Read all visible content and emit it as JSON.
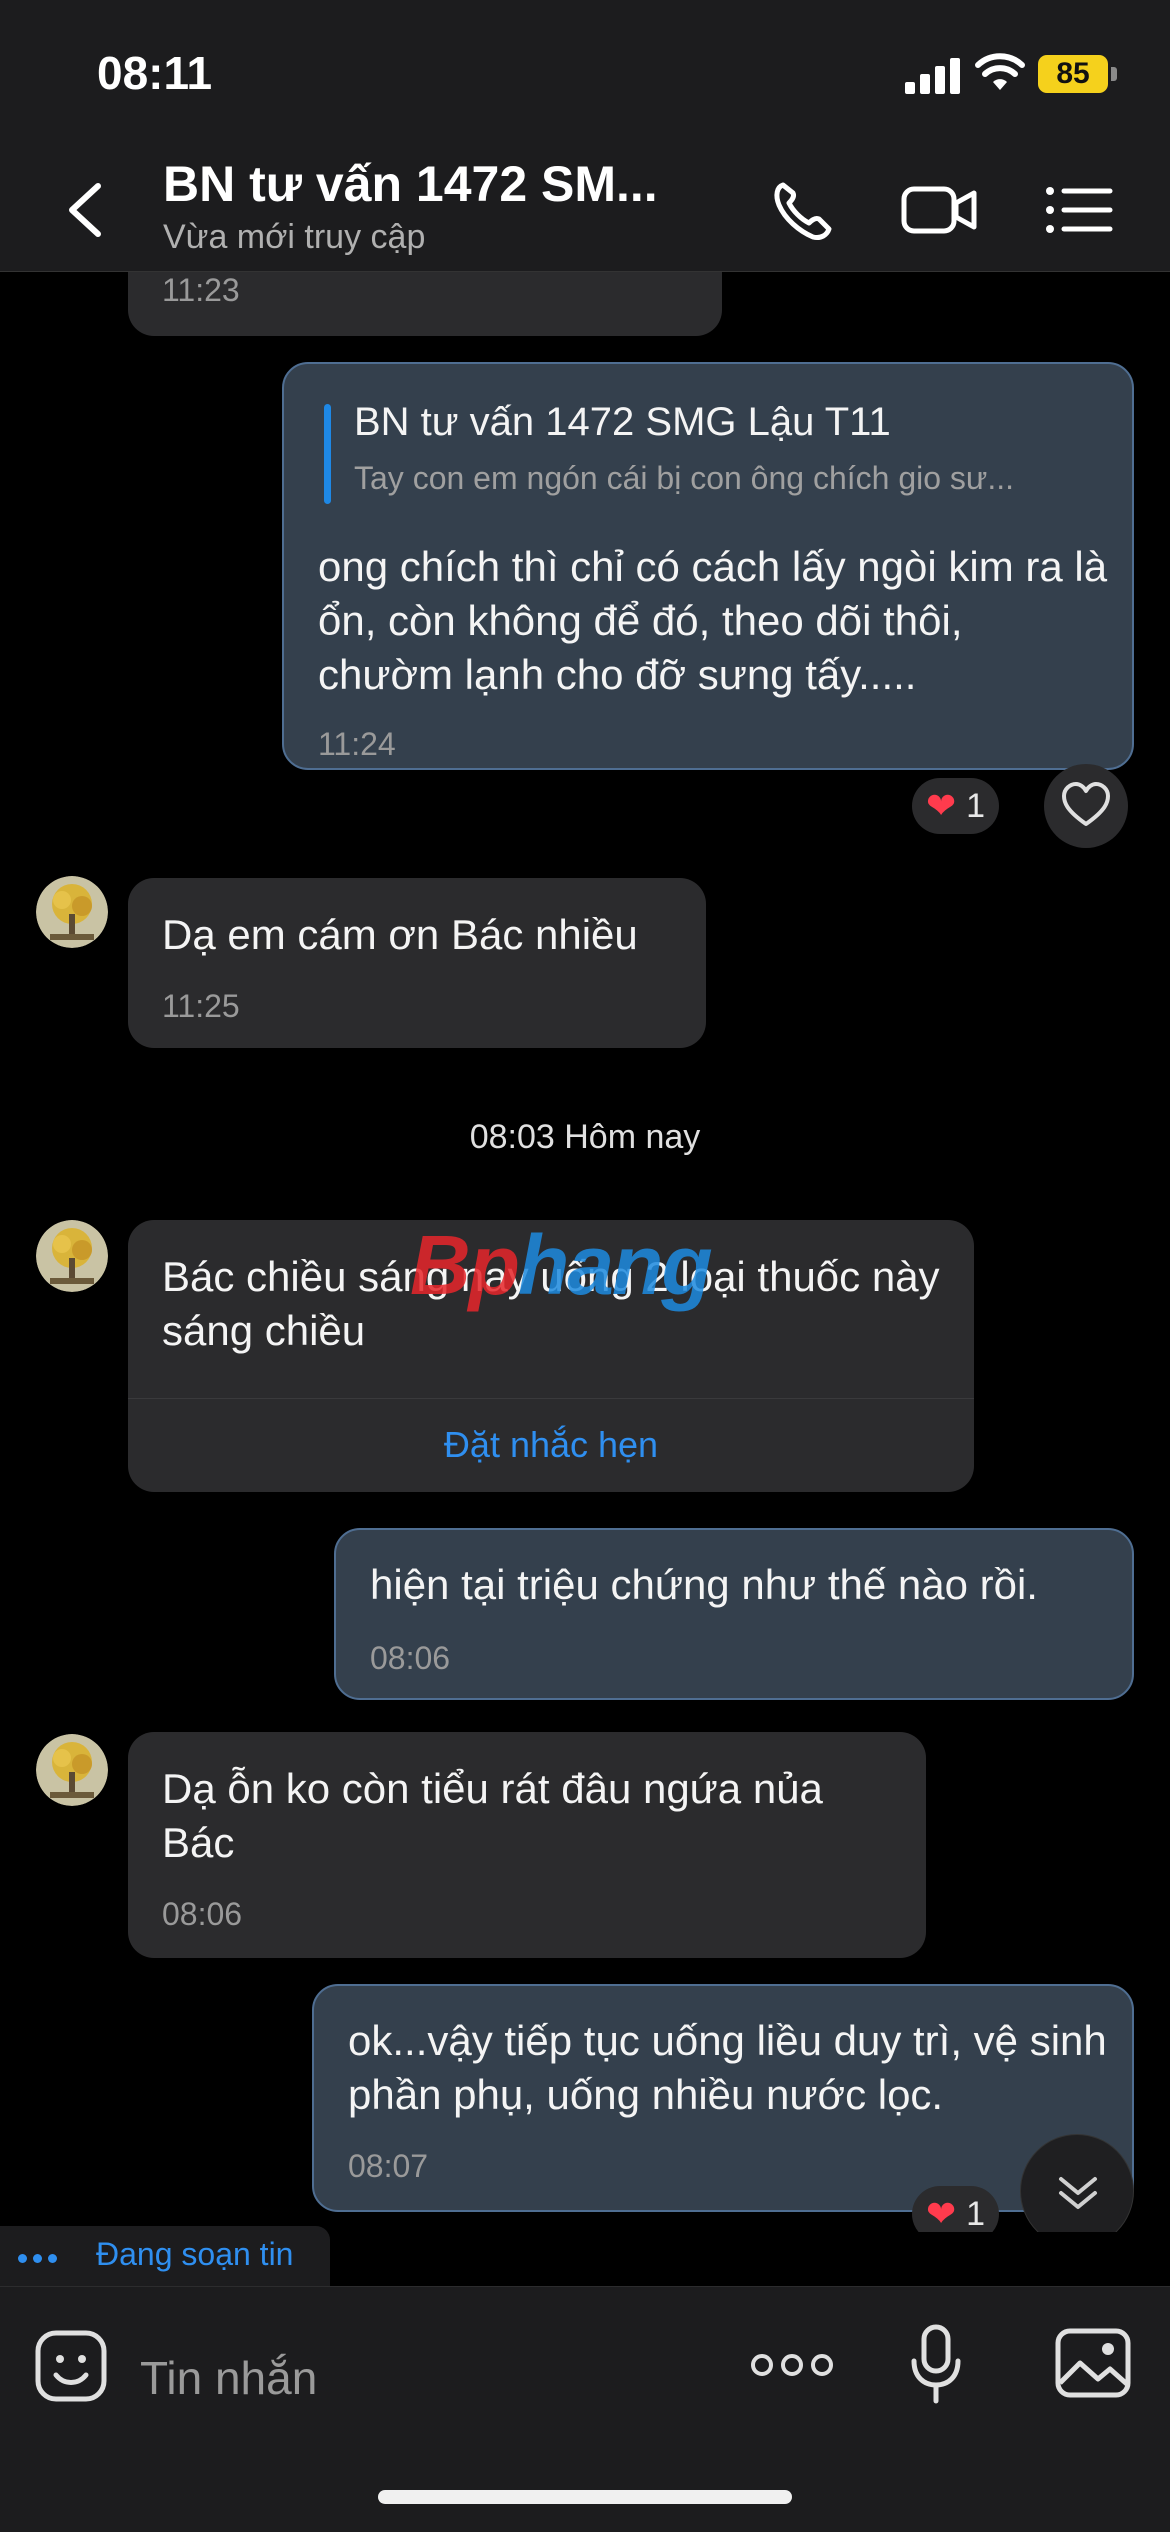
{
  "status_bar": {
    "time": "08:11",
    "battery": "85"
  },
  "header": {
    "title": "BN tư vấn 1472 SM...",
    "subtitle": "Vừa mới truy cập",
    "icons": [
      "back-chevron-icon",
      "phone-icon",
      "video-call-icon",
      "list-menu-icon"
    ]
  },
  "messages": [
    {
      "id": "m0",
      "direction": "in",
      "time": "11:23"
    },
    {
      "id": "m1",
      "direction": "out",
      "reply_to": {
        "name": "BN tư vấn 1472 SMG Lậu T11",
        "snippet": "Tay con em ngón cái bị con ông chích gio sư..."
      },
      "text": "ong chích thì chỉ có cách lấy ngòi kim ra là ổn, còn không để đó, theo dõi thôi, chườm lạnh cho đỡ sưng tấy.....",
      "time": "11:24",
      "reaction": {
        "emoji": "❤",
        "count": "1"
      }
    },
    {
      "id": "m2",
      "direction": "in",
      "text": "Dạ em cám ơn Bác nhiều",
      "time": "11:25"
    },
    {
      "id": "m3",
      "direction": "in",
      "text": "Bác chiều sáng nay uống 2 loại thuốc này sáng chiều",
      "action": "Đặt nhắc hẹn"
    },
    {
      "id": "m4",
      "direction": "out",
      "text": "hiện tại triệu chứng như thế nào rồi.",
      "time": "08:06"
    },
    {
      "id": "m5",
      "direction": "in",
      "text": "Dạ ỗn ko còn tiểu rát đâu ngứa nủa Bác",
      "time": "08:06"
    },
    {
      "id": "m6",
      "direction": "out",
      "text": "ok...vậy tiếp tục uống liều duy trì, vệ sinh phần phụ, uống nhiều nước lọc.",
      "time": "08:07",
      "reaction": {
        "emoji": "❤",
        "count": "1"
      }
    }
  ],
  "date_separator": "08:03 Hôm nay",
  "watermark": {
    "part1": "Bp",
    "part2": "hang"
  },
  "typing_indicator": "Đang soạn tin",
  "composer": {
    "placeholder": "Tin nhắn",
    "icons": [
      "sticker-icon",
      "more-icon",
      "microphone-icon",
      "image-icon"
    ]
  },
  "colors": {
    "accent": "#2f8ff0",
    "outgoing_bubble": "#34404d",
    "incoming_bubble": "#2b2b2d",
    "battery": "#f5d11c",
    "heart": "#ff3b4d"
  }
}
